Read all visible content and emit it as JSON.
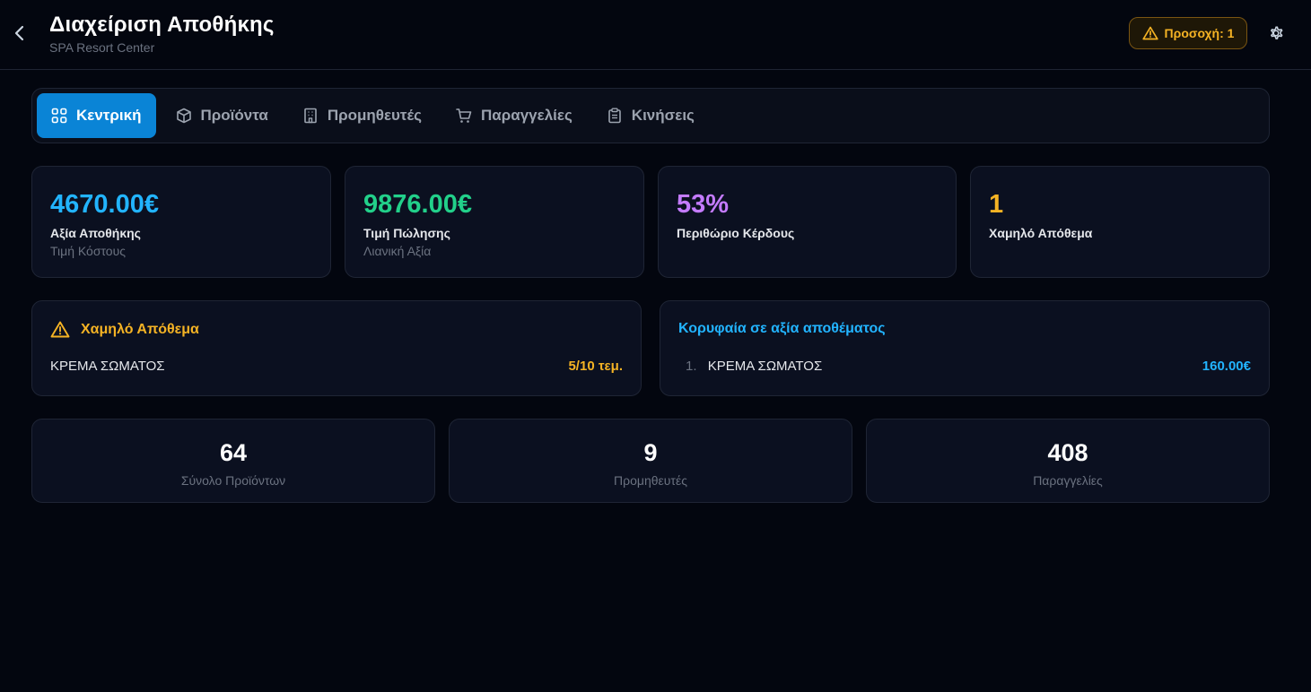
{
  "header": {
    "title": "Διαχείριση Αποθήκης",
    "subtitle": "SPA Resort Center",
    "alert_label": "Προσοχή: 1"
  },
  "tabs": [
    {
      "label": "Κεντρική",
      "icon": "dashboard-grid-icon",
      "active": true
    },
    {
      "label": "Προϊόντα",
      "icon": "box-icon",
      "active": false
    },
    {
      "label": "Προμηθευτές",
      "icon": "building-icon",
      "active": false
    },
    {
      "label": "Παραγγελίες",
      "icon": "cart-icon",
      "active": false
    },
    {
      "label": "Κινήσεις",
      "icon": "clipboard-icon",
      "active": false
    }
  ],
  "stats": [
    {
      "value": "4670.00€",
      "label": "Αξία Αποθήκης",
      "sub": "Τιμή Κόστους",
      "color": "#22b4ff"
    },
    {
      "value": "9876.00€",
      "label": "Τιμή Πώλησης",
      "sub": "Λιανική Αξία",
      "color": "#22d08a"
    },
    {
      "value": "53%",
      "label": "Περιθώριο Κέρδους",
      "color": "#c47bff"
    },
    {
      "value": "1",
      "label": "Χαμηλό Απόθεμα",
      "color": "#f5b324"
    }
  ],
  "low_stock": {
    "title": "Χαμηλό Απόθεμα",
    "items": [
      {
        "name": "ΚΡΕΜΑ ΣΩΜΑΤΟΣ",
        "qty": "5/10 τεμ."
      }
    ]
  },
  "top_value": {
    "title": "Κορυφαία σε αξία αποθέματος",
    "items": [
      {
        "rank": "1.",
        "name": "ΚΡΕΜΑ ΣΩΜΑΤΟΣ",
        "value": "160.00€"
      }
    ]
  },
  "totals": [
    {
      "value": "64",
      "label": "Σύνολο Προϊόντων"
    },
    {
      "value": "9",
      "label": "Προμηθευτές"
    },
    {
      "value": "408",
      "label": "Παραγγελίες"
    }
  ],
  "colors": {
    "accent": "#0a84d6",
    "warning": "#f5b324",
    "info": "#22b4ff"
  }
}
